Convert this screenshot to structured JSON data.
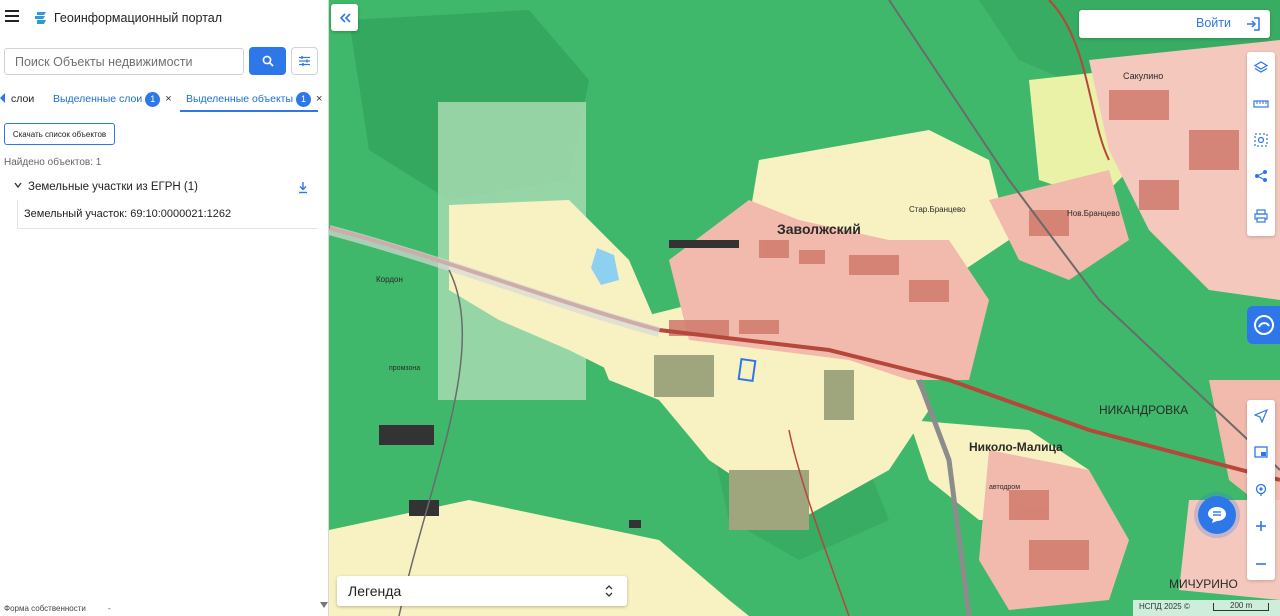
{
  "header": {
    "title": "Геоинформационный портал",
    "menu_icon": "hamburger-menu-icon",
    "logo_icon": "portal-logo-icon"
  },
  "search": {
    "placeholder": "Поиск Объекты недвижимости",
    "value": "",
    "button_icon": "search-icon",
    "filter_icon": "filter-icon"
  },
  "tabs": [
    {
      "label": "слои",
      "active": false
    },
    {
      "label": "Выделенные слои",
      "badge": "1",
      "close": "×",
      "active": false
    },
    {
      "label": "Выделенные объекты",
      "badge": "1",
      "close": "×",
      "active": true
    }
  ],
  "results": {
    "download_list_label": "Скачать список объектов",
    "found_text": "Найдено объектов: 1",
    "group_title": "Земельные участки из ЕГРН (1)",
    "group_download_icon": "download-icon",
    "items": [
      {
        "label": "Земельный участок: 69:10:0000021:1262"
      }
    ]
  },
  "footer": {
    "ownership_label": "Форма собственности",
    "dash": "-"
  },
  "map": {
    "collapse_icon": "double-chevron-left-icon",
    "login_label": "Войти",
    "login_icon": "login-icon",
    "tools": [
      "layers-icon",
      "ruler-icon",
      "select-area-icon",
      "share-icon",
      "print-icon"
    ],
    "tools_bottom": [
      "locate-icon",
      "minimap-icon",
      "search-location-icon",
      "zoom-in-icon",
      "zoom-out-icon"
    ],
    "place_labels": {
      "zavolzhsky": "Заволжский",
      "nikandrovka": "НИКАНДРОВКА",
      "nikolo_malitsa": "Николо-Малица",
      "michurino": "МИЧУРИНО",
      "sakulino": "Сакулино",
      "nov_brantsevo": "Нов.Бранцево",
      "star_brantsevo": "Стар.Бранцево",
      "kordon": "Кордон",
      "avtodrom": "автодром",
      "promzona": "промзона"
    },
    "legend_label": "Легенда",
    "attribution": "НСПД 2025 ©",
    "scale_label": "200 m",
    "colors": {
      "forest": "#3fb86b",
      "field": "#f8f2c2",
      "settlement": "#f2b9ad",
      "road": "#b5473b",
      "accent": "#2e77e8"
    }
  }
}
